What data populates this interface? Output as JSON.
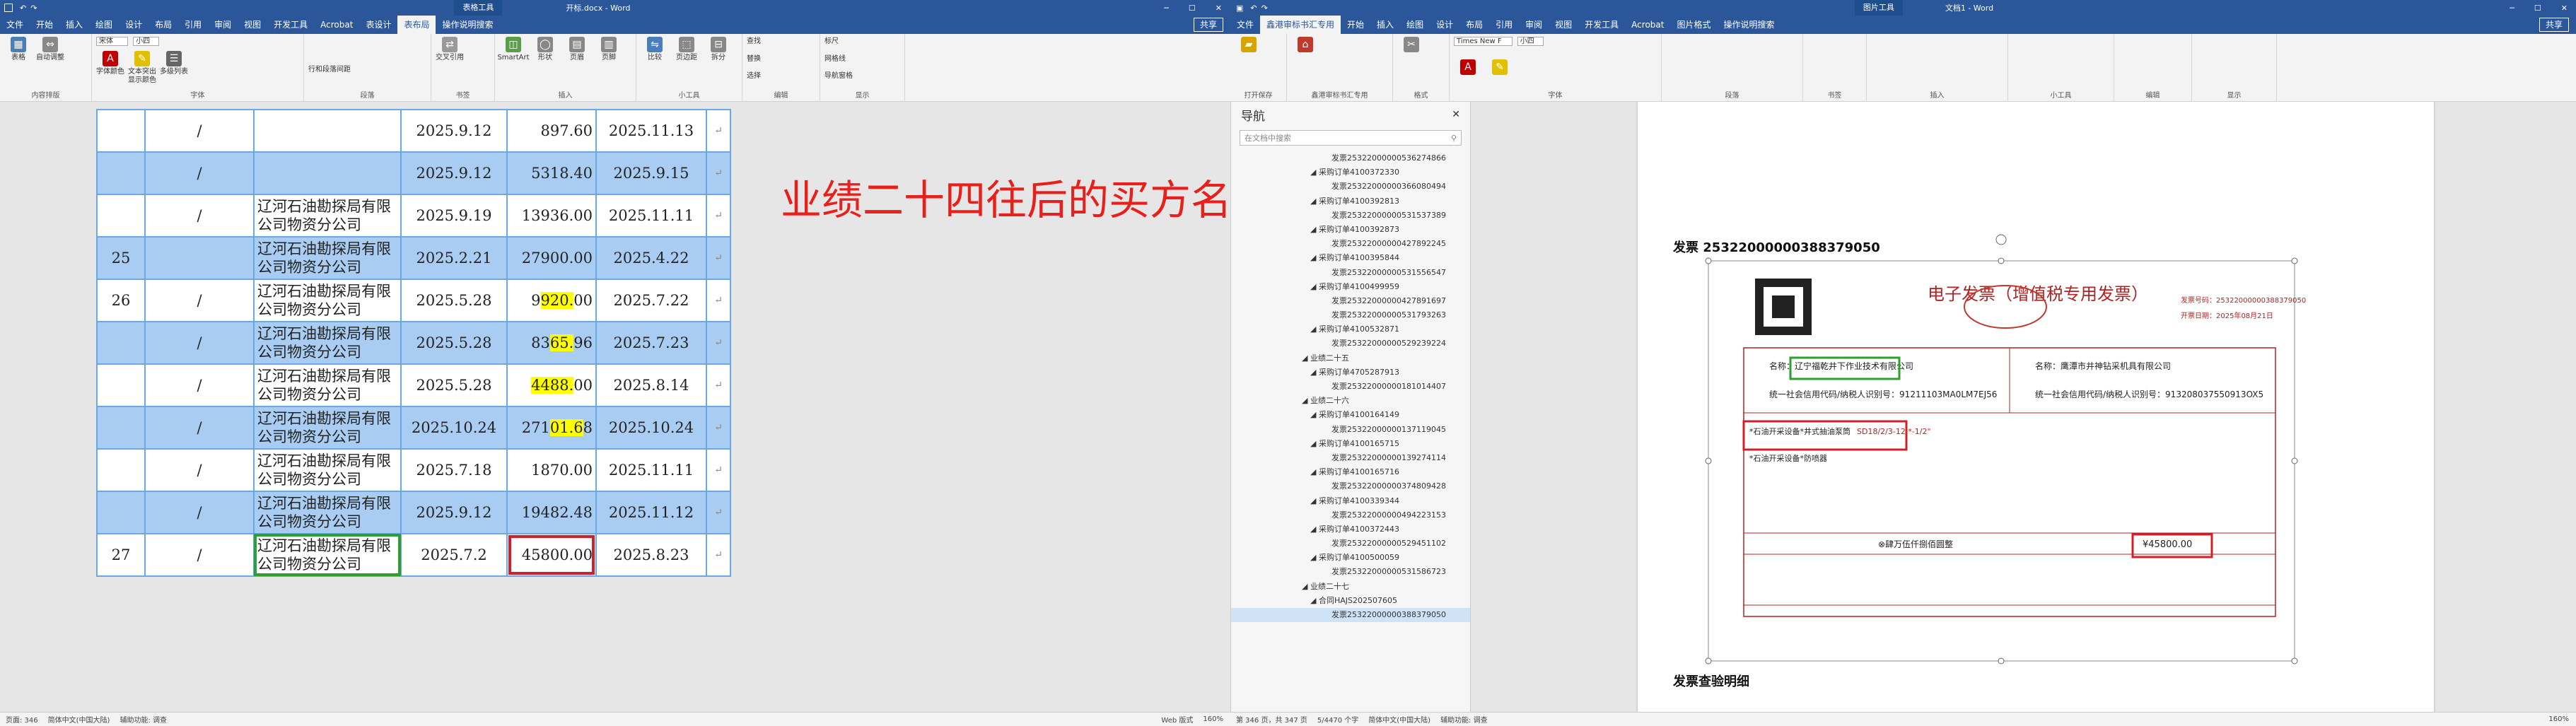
{
  "left_window": {
    "title": "开标.docx - Word",
    "context_tab": "表格工具",
    "tabs": [
      "文件",
      "开始",
      "插入",
      "绘图",
      "设计",
      "布局",
      "引用",
      "审阅",
      "视图",
      "开发工具",
      "Acrobat",
      "表设计",
      "表布局",
      "操作说明搜索"
    ],
    "share_label": "共享",
    "ribbon_groups": [
      {
        "label": "",
        "buttons": [
          "表格",
          "自动调整"
        ]
      },
      {
        "label": "内容排版",
        "buttons": [
          "清除",
          "格式"
        ]
      },
      {
        "label": "字体",
        "buttons": [
          "字体颜色",
          "文本突出显示颜色",
          "多级列表"
        ]
      },
      {
        "label": "段落",
        "buttons": [
          "行和段落间距"
        ]
      },
      {
        "label": "书签",
        "buttons": [
          "交叉引用"
        ]
      },
      {
        "label": "插入",
        "buttons": [
          "SmartArt",
          "形状",
          "页眉",
          "页脚"
        ]
      },
      {
        "label": "",
        "buttons": [
          "比较",
          "页边距",
          "拆分"
        ]
      },
      {
        "label": "小工具",
        "buttons": [
          "查找",
          "替换",
          "选择"
        ]
      },
      {
        "label": "编辑",
        "buttons": [
          "标尺",
          "网格线",
          "导航窗格"
        ]
      },
      {
        "label": "显示",
        "buttons": []
      }
    ],
    "font_name": "宋体",
    "font_size": "小四",
    "status": {
      "page": "页面: 346",
      "section": "辅助功能: 调查",
      "lang": "简体中文(中国大陆)",
      "mode": "Web 版式",
      "zoom": "160%"
    }
  },
  "table_rows": [
    {
      "no": "",
      "mark": "/",
      "buyer": "",
      "date": "2025.9.12",
      "amount": "897.60",
      "due": "2025.11.13",
      "style": "wh"
    },
    {
      "no": "",
      "mark": "/",
      "buyer": "",
      "date": "2025.9.12",
      "amount": "5318.40",
      "due": "2025.9.15",
      "style": "hl"
    },
    {
      "no": "",
      "mark": "/",
      "buyer": "辽河石油勘探局有限公司物资分公司",
      "date": "2025.9.19",
      "amount": "13936.00",
      "due": "2025.11.11",
      "style": "wh"
    },
    {
      "no": "25",
      "mark": "",
      "buyer": "辽河石油勘探局有限公司物资分公司",
      "date": "2025.2.21",
      "amount": "27900.00",
      "due": "2025.4.22",
      "style": "hl"
    },
    {
      "no": "26",
      "mark": "/",
      "buyer": "辽河石油勘探局有限公司物资分公司",
      "date": "2025.5.28",
      "amount": "9920.00",
      "due": "2025.7.22",
      "style": "wh",
      "yellow": "920."
    },
    {
      "no": "",
      "mark": "/",
      "buyer": "辽河石油勘探局有限公司物资分公司",
      "date": "2025.5.28",
      "amount": "8365.96",
      "due": "2025.7.23",
      "style": "hl",
      "yellow": "65."
    },
    {
      "no": "",
      "mark": "/",
      "buyer": "辽河石油勘探局有限公司物资分公司",
      "date": "2025.5.28",
      "amount": "4488.00",
      "due": "2025.8.14",
      "style": "wh",
      "yellow": "4488."
    },
    {
      "no": "",
      "mark": "/",
      "buyer": "辽河石油勘探局有限公司物资分公司",
      "date": "2025.10.24",
      "amount": "27101.68",
      "due": "2025.10.24",
      "style": "hl",
      "yellow": "01.6"
    },
    {
      "no": "",
      "mark": "/",
      "buyer": "辽河石油勘探局有限公司物资分公司",
      "date": "2025.7.18",
      "amount": "1870.00",
      "due": "2025.11.11",
      "style": "wh"
    },
    {
      "no": "",
      "mark": "/",
      "buyer": "辽河石油勘探局有限公司物资分公司",
      "date": "2025.9.12",
      "amount": "19482.48",
      "due": "2025.11.12",
      "style": "hl"
    },
    {
      "no": "27",
      "mark": "/",
      "buyer": "辽河石油勘探局有限公司物资分公司",
      "date": "2025.7.2",
      "amount": "45800.00",
      "due": "2025.8.23",
      "style": "wh",
      "green_box": true,
      "red_box": true
    }
  ],
  "annotation_note": "业绩二十四往后的买方名称都不对",
  "right_window": {
    "title": "文档1 - Word",
    "context_tab": "图片工具",
    "tabs": [
      "文件",
      "鑫港审标书汇专用",
      "开始",
      "插入",
      "绘图",
      "设计",
      "布局",
      "引用",
      "审阅",
      "视图",
      "开发工具",
      "Acrobat",
      "图片格式",
      "操作说明搜索"
    ],
    "share_label": "共享",
    "ribbon_labels": [
      "打开保存",
      "鑫港审标书汇专用",
      "格式",
      "字体",
      "段落",
      "书签",
      "插入",
      "小工具",
      "编辑",
      "显示"
    ],
    "font_name": "Times New F",
    "font_size": "小四",
    "status": {
      "page": "第 346 页，共 347 页",
      "words": "5/4470 个字",
      "lang": "简体中文(中国大陆)",
      "section": "辅助功能: 调查",
      "zoom": "160%"
    }
  },
  "nav": {
    "title": "导航",
    "search_placeholder": "在文档中搜索",
    "items": [
      {
        "text": "发票25322000000536274866",
        "level": 3
      },
      {
        "text": "采购订单4100372330",
        "level": 2
      },
      {
        "text": "发票25322000000366080494",
        "level": 3
      },
      {
        "text": "采购订单4100392813",
        "level": 2
      },
      {
        "text": "发票25322000000531537389",
        "level": 3
      },
      {
        "text": "采购订单4100392873",
        "level": 2
      },
      {
        "text": "发票25322000000427892245",
        "level": 3
      },
      {
        "text": "采购订单4100395844",
        "level": 2
      },
      {
        "text": "发票25322000000531556547",
        "level": 3
      },
      {
        "text": "采购订单4100499959",
        "level": 2
      },
      {
        "text": "发票25322000000427891697",
        "level": 3
      },
      {
        "text": "发票25322000000531793263",
        "level": 3
      },
      {
        "text": "采购订单4100532871",
        "level": 2
      },
      {
        "text": "发票25322000000529239224",
        "level": 3
      },
      {
        "text": "业绩二十五",
        "level": 1
      },
      {
        "text": "采购订单4705287913",
        "level": 2
      },
      {
        "text": "发票25322000000181014407",
        "level": 3
      },
      {
        "text": "业绩二十六",
        "level": 1
      },
      {
        "text": "采购订单4100164149",
        "level": 2
      },
      {
        "text": "发票25322000000137119045",
        "level": 3
      },
      {
        "text": "采购订单4100165715",
        "level": 2
      },
      {
        "text": "发票25322000000139274114",
        "level": 3
      },
      {
        "text": "采购订单4100165716",
        "level": 2
      },
      {
        "text": "发票25322000000374809428",
        "level": 3
      },
      {
        "text": "采购订单4100339344",
        "level": 2
      },
      {
        "text": "发票25322000000494223153",
        "level": 3
      },
      {
        "text": "采购订单4100372443",
        "level": 2
      },
      {
        "text": "发票25322000000529451102",
        "level": 3
      },
      {
        "text": "采购订单4100500059",
        "level": 2
      },
      {
        "text": "发票25322000000531586723",
        "level": 3
      },
      {
        "text": "业绩二十七",
        "level": 1
      },
      {
        "text": "合同HAJS202507605",
        "level": 2
      },
      {
        "text": "发票25322000000388379050",
        "level": 3,
        "selected": true
      }
    ]
  },
  "invoice": {
    "heading": "发票 25322000000388379050",
    "title": "电子发票（增值税专用发票）",
    "no_label": "发票号码：25322000000388379050",
    "date_label": "开票日期：2025年08月21日",
    "buyer_name": "名称：辽宁福乾井下作业技术有限公司",
    "buyer_tax": "统一社会信用代码/纳税人识别号：91211103MA0LM7EJ56",
    "seller_name": "名称：鹰潭市井神钻采机具有限公司",
    "seller_tax": "统一社会信用代码/纳税人识别号：913208037550913OX5",
    "item1": "*石油开采设备*井式抽油泵筒",
    "item1_spec": "SD18/2/3-12.*-1/2\"",
    "item2": "*石油开采设备*防喷器",
    "total_words": "⊗肆万伍仟捌佰圆整",
    "total_amount": "¥45800.00",
    "detail_heading": "发票查验明细"
  },
  "colors": {
    "word_blue": "#2b579a",
    "table_highlight": "#a9cdf2",
    "table_border": "#6aa8e6",
    "note_red": "#e8201c",
    "invoice_red": "#b22222"
  }
}
